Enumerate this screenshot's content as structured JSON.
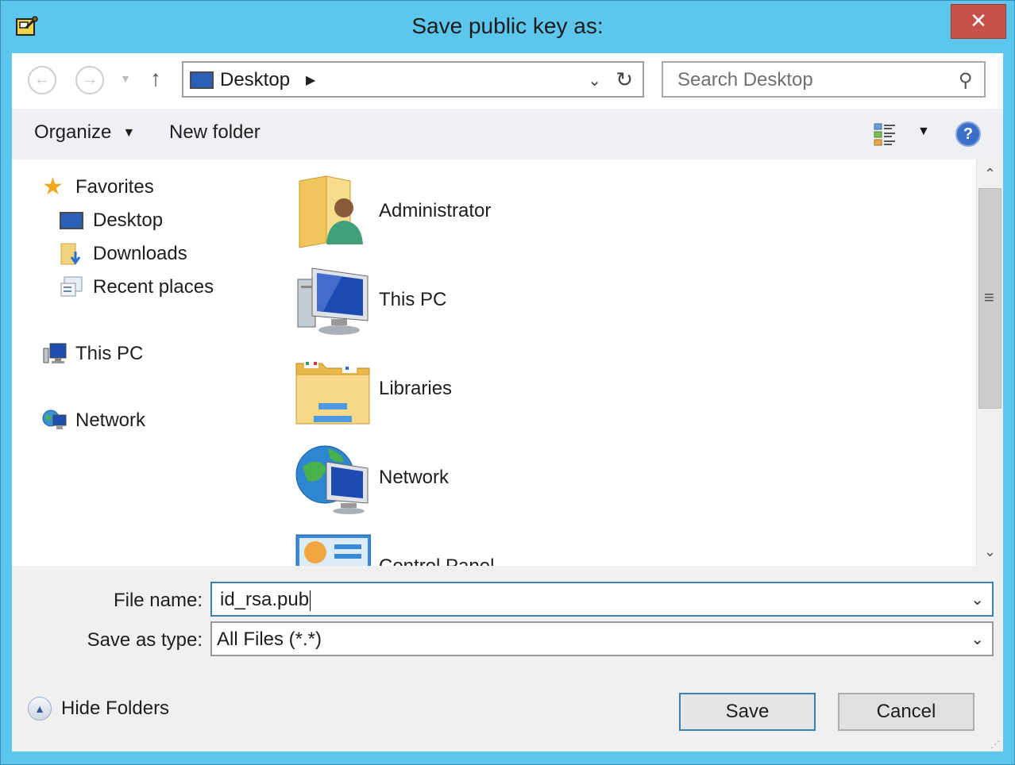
{
  "window": {
    "title": "Save public key as:",
    "close_label": "✕"
  },
  "nav": {
    "back_icon": "back-arrow-icon",
    "forward_icon": "forward-arrow-icon",
    "recent_dropdown_icon": "chevron-down-icon",
    "up_icon": "up-arrow-icon",
    "address": {
      "location": "Desktop",
      "separator": "▶",
      "dropdown": "⌄",
      "refresh": "↻"
    },
    "search": {
      "placeholder": "Search Desktop"
    }
  },
  "toolbar": {
    "organize_label": "Organize",
    "organize_caret": "▼",
    "new_folder_label": "New folder",
    "view_caret": "▼",
    "help_label": "?"
  },
  "navpane": {
    "favorites_label": "Favorites",
    "desktop_label": "Desktop",
    "downloads_label": "Downloads",
    "recent_label": "Recent places",
    "thispc_label": "This PC",
    "network_label": "Network"
  },
  "content": {
    "items": [
      {
        "label": "Administrator",
        "icon": "user-folder-icon"
      },
      {
        "label": "This PC",
        "icon": "computer-icon"
      },
      {
        "label": "Libraries",
        "icon": "libraries-folder-icon"
      },
      {
        "label": "Network",
        "icon": "network-globe-icon"
      },
      {
        "label": "Control Panel",
        "icon": "control-panel-icon"
      }
    ]
  },
  "scrollbar": {
    "up": "⌃",
    "down": "⌄",
    "grip": "≡"
  },
  "form": {
    "filename_label": "File name:",
    "filename_value": "id_rsa.pub",
    "savetype_label": "Save as type:",
    "savetype_value": "All Files (*.*)",
    "dropdown_glyph": "⌄"
  },
  "footer": {
    "hide_folders_label": "Hide Folders",
    "hide_folders_glyph": "▲",
    "save_label": "Save",
    "cancel_label": "Cancel"
  },
  "colors": {
    "titlebar": "#5cc6ec",
    "close": "#c7504a",
    "accent": "#3c7fb1"
  }
}
